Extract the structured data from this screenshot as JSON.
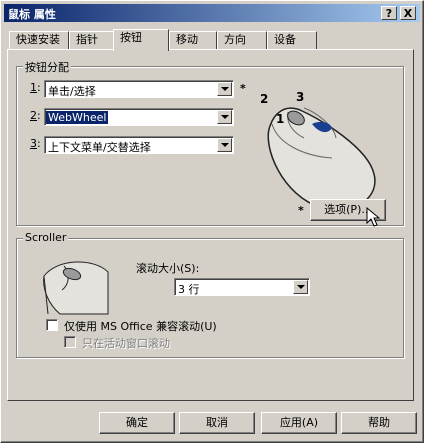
{
  "window": {
    "title": "鼠标 属性",
    "help_btn": "?",
    "close_btn": "X"
  },
  "tabs": [
    {
      "label": "快速安装"
    },
    {
      "label": "指针"
    },
    {
      "label": "按钮"
    },
    {
      "label": "移动"
    },
    {
      "label": "方向"
    },
    {
      "label": "设备"
    }
  ],
  "active_tab": "按钮",
  "assign": {
    "group_label": "按钮分配",
    "rows": [
      {
        "num": "1",
        "colon": ":",
        "value": "单击/选择"
      },
      {
        "num": "2",
        "colon": ":",
        "value": "WebWheel"
      },
      {
        "num": "3",
        "colon": ":",
        "value": "上下文菜单/交替选择"
      }
    ],
    "star": "*",
    "mouse_labels": {
      "one": "1",
      "two": "2",
      "three": "3"
    },
    "options_star": "*",
    "options_button": "选项(P)..."
  },
  "scroller": {
    "group_label": "Scroller",
    "size_label": "滚动大小(S):",
    "size_value": "3 行",
    "office_label": "仅使用 MS Office 兼容滚动(U)",
    "active_label": "只在活动窗口滚动"
  },
  "footer": {
    "ok": "确定",
    "cancel": "取消",
    "apply": "应用(A)",
    "help": "帮助"
  }
}
